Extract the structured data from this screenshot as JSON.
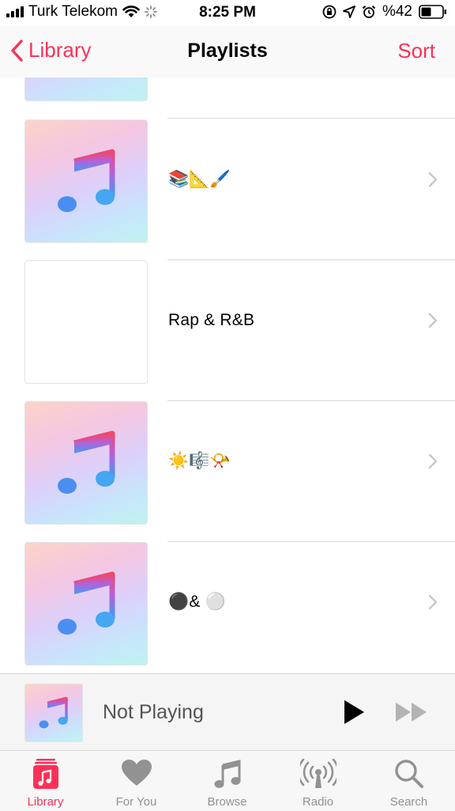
{
  "status_bar": {
    "carrier": "Turk Telekom",
    "time": "8:25 PM",
    "battery": "%42",
    "icons": [
      "signal-bars-icon",
      "wifi-icon",
      "activity-spinner-icon",
      "orientation-lock-icon",
      "location-arrow-icon",
      "alarm-icon",
      "battery-icon"
    ]
  },
  "nav": {
    "back_label": "Library",
    "title": "Playlists",
    "sort_label": "Sort"
  },
  "playlists": [
    {
      "name": "📚📐🖌️",
      "art": "music-note"
    },
    {
      "name": "Rap & R&B",
      "art": "blank"
    },
    {
      "name": "☀️🎼📯",
      "art": "music-note"
    },
    {
      "name": "⚫️& ⚪️",
      "art": "music-note"
    }
  ],
  "mini_player": {
    "title": "Not Playing"
  },
  "tabs": [
    {
      "label": "Library",
      "icon": "library-icon",
      "active": true
    },
    {
      "label": "For You",
      "icon": "heart-icon",
      "active": false
    },
    {
      "label": "Browse",
      "icon": "music-note-icon",
      "active": false
    },
    {
      "label": "Radio",
      "icon": "radio-icon",
      "active": false
    },
    {
      "label": "Search",
      "icon": "search-icon",
      "active": false
    }
  ],
  "colors": {
    "accent": "#fc3158",
    "tab_inactive": "#929292",
    "separator": "#d9d9dc"
  }
}
